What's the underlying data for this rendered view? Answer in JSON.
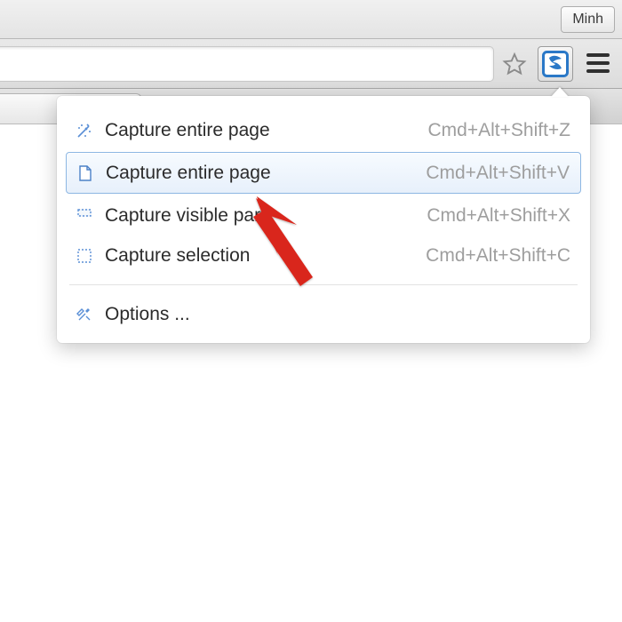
{
  "toolbar": {
    "profile_label": "Minh",
    "extension_name": "snagit-extension"
  },
  "popup": {
    "items": [
      {
        "label": "Capture entire page",
        "shortcut": "Cmd+Alt+Shift+Z",
        "icon": "wand"
      },
      {
        "label": "Capture entire page",
        "shortcut": "Cmd+Alt+Shift+V",
        "icon": "page",
        "selected": true
      },
      {
        "label": "Capture visible part",
        "shortcut": "Cmd+Alt+Shift+X",
        "icon": "visible"
      },
      {
        "label": "Capture selection",
        "shortcut": "Cmd+Alt+Shift+C",
        "icon": "selection"
      }
    ],
    "options_label": "Options ..."
  }
}
